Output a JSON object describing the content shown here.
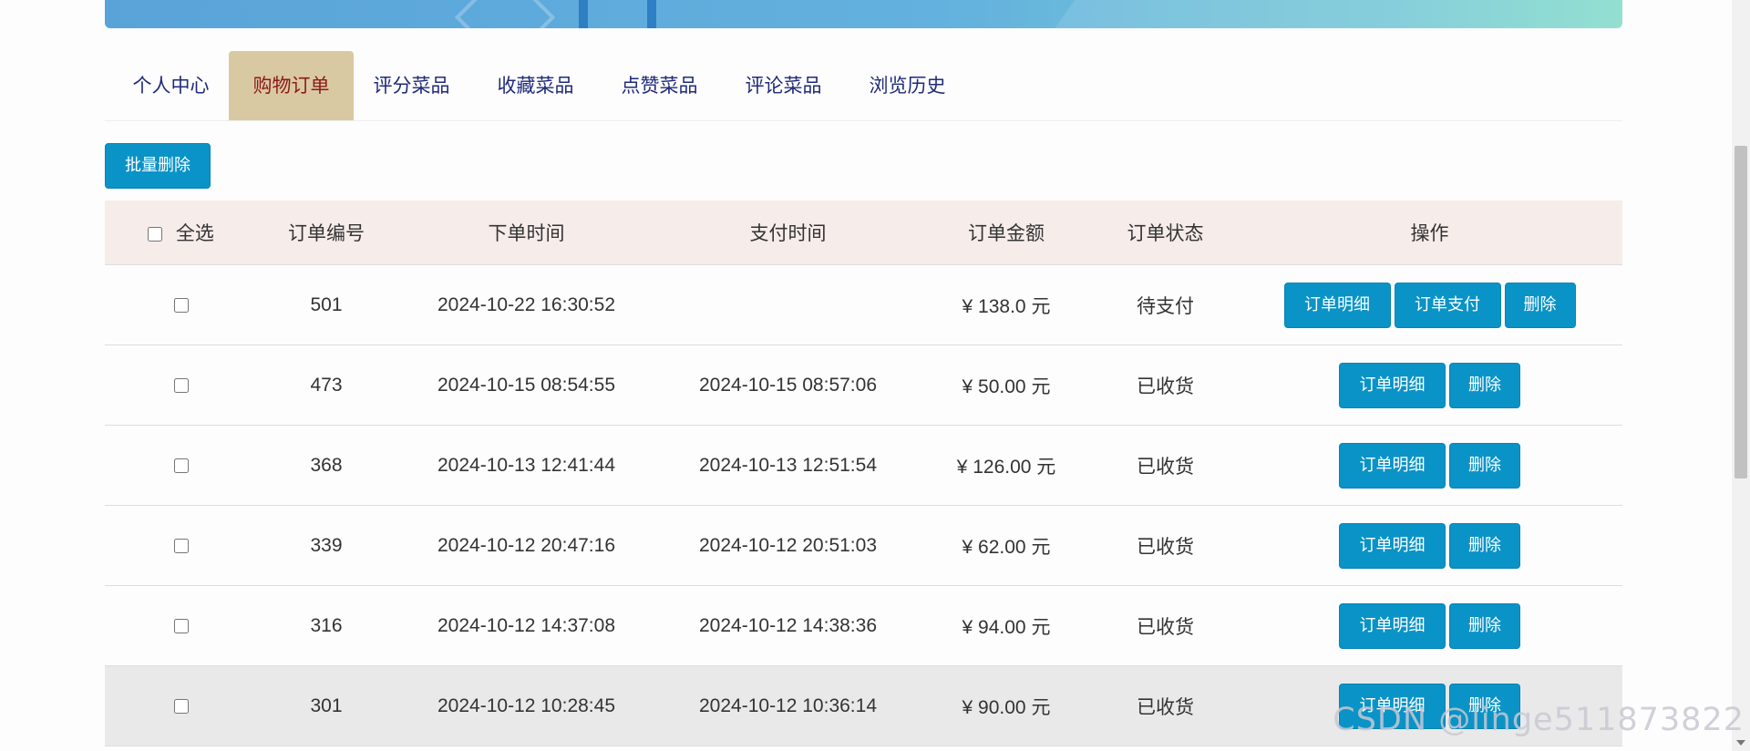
{
  "tabs": [
    {
      "label": "个人中心"
    },
    {
      "label": "购物订单"
    },
    {
      "label": "评分菜品"
    },
    {
      "label": "收藏菜品"
    },
    {
      "label": "点赞菜品"
    },
    {
      "label": "评论菜品"
    },
    {
      "label": "浏览历史"
    }
  ],
  "toolbar": {
    "batch_delete": "批量删除"
  },
  "table": {
    "headers": {
      "select_all": "全选",
      "order_no": "订单编号",
      "order_time": "下单时间",
      "pay_time": "支付时间",
      "amount": "订单金额",
      "status": "订单状态",
      "actions": "操作"
    },
    "rows": [
      {
        "order_no": "501",
        "order_time": "2024-10-22 16:30:52",
        "pay_time": "",
        "amount": "¥ 138.0 元",
        "status": "待支付"
      },
      {
        "order_no": "473",
        "order_time": "2024-10-15 08:54:55",
        "pay_time": "2024-10-15 08:57:06",
        "amount": "¥ 50.00 元",
        "status": "已收货"
      },
      {
        "order_no": "368",
        "order_time": "2024-10-13 12:41:44",
        "pay_time": "2024-10-13 12:51:54",
        "amount": "¥ 126.00 元",
        "status": "已收货"
      },
      {
        "order_no": "339",
        "order_time": "2024-10-12 20:47:16",
        "pay_time": "2024-10-12 20:51:03",
        "amount": "¥ 62.00 元",
        "status": "已收货"
      },
      {
        "order_no": "316",
        "order_time": "2024-10-12 14:37:08",
        "pay_time": "2024-10-12 14:38:36",
        "amount": "¥ 94.00 元",
        "status": "已收货"
      },
      {
        "order_no": "301",
        "order_time": "2024-10-12 10:28:45",
        "pay_time": "2024-10-12 10:36:14",
        "amount": "¥ 90.00 元",
        "status": "已收货"
      }
    ],
    "buttons": {
      "detail": "订单明细",
      "pay": "订单支付",
      "delete": "删除"
    }
  },
  "watermark": "CSDN @linge511873822",
  "colors": {
    "primary_button": "#0a93c6",
    "active_tab_bg": "#d9c9a3",
    "active_tab_text": "#8b1a1a",
    "header_bg": "#f6ecea"
  }
}
